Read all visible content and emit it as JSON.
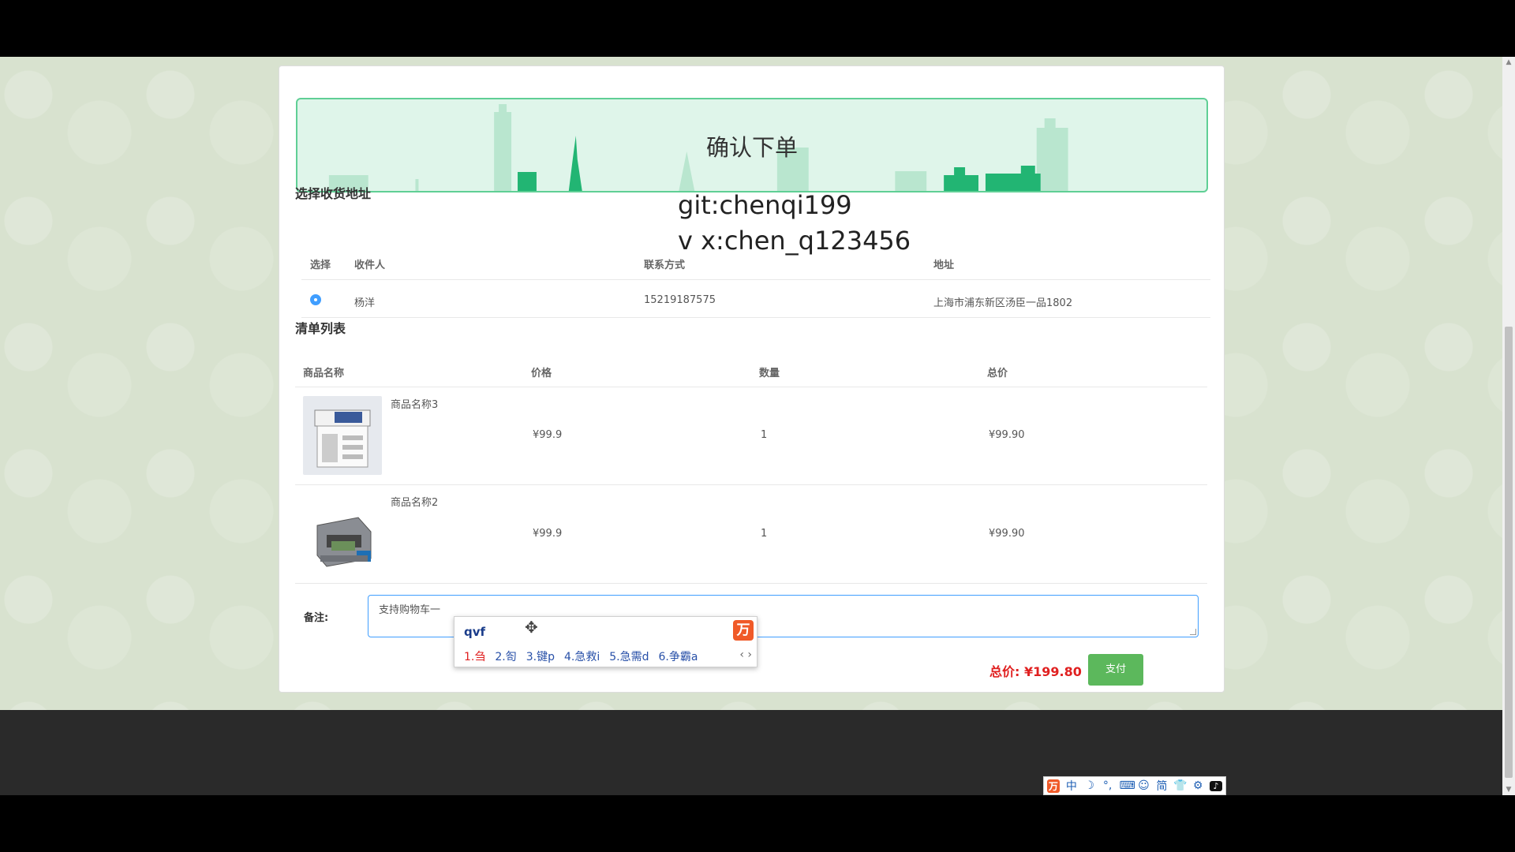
{
  "banner": {
    "title": "确认下单"
  },
  "address_section": {
    "title": "选择收货地址",
    "headers": {
      "select": "选择",
      "recipient": "收件人",
      "contact": "联系方式",
      "address": "地址"
    },
    "rows": [
      {
        "recipient": "杨洋",
        "contact": "15219187575",
        "address": "上海市浦东新区汤臣一品1802",
        "selected": true
      }
    ]
  },
  "watermark": {
    "line1": "git:chenqi199",
    "line2": "v x:chen_q123456"
  },
  "cart_section": {
    "title": "清单列表",
    "headers": {
      "name": "商品名称",
      "price": "价格",
      "qty": "数量",
      "total": "总价"
    },
    "rows": [
      {
        "name": "商品名称3",
        "price": "¥99.9",
        "qty": "1",
        "total": "¥99.90",
        "image_icon": "copier-machine-image"
      },
      {
        "name": "商品名称2",
        "price": "¥99.9",
        "qty": "1",
        "total": "¥99.90",
        "image_icon": "money-counter-image"
      }
    ]
  },
  "remark": {
    "label": "备注:",
    "value": "支持购物车一"
  },
  "ime": {
    "input": "qvf",
    "candidates": [
      "1.刍",
      "2.匌",
      "3.键p",
      "4.急救i",
      "5.急需d",
      "6.争霸a"
    ],
    "arrows": "‹ ›",
    "logo": "万"
  },
  "summary": {
    "total_label": "总价:",
    "total_value": "¥199.80",
    "pay_label": "支付"
  },
  "taskbar_tray": {
    "items": [
      "万",
      "中",
      "☽",
      "°,",
      "⌨",
      "☺",
      "简",
      "👕",
      "⚙",
      "♪"
    ]
  },
  "colors": {
    "accent": "#409eff",
    "pay": "#5cb85c",
    "price_red": "#e02020",
    "banner_border": "#5fcf95"
  }
}
